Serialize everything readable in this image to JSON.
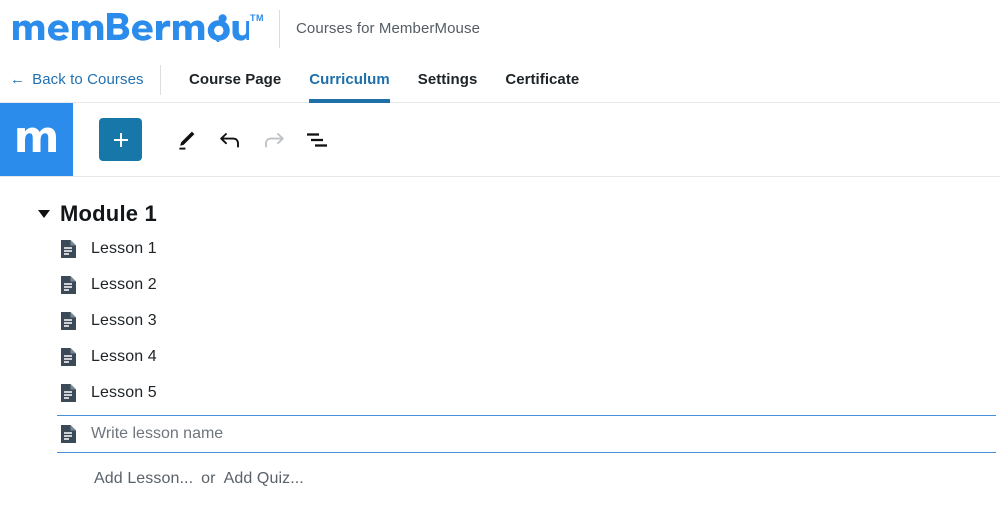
{
  "header": {
    "logo_text": "membermouse",
    "logo_tm": "TM",
    "title": "Courses for MemberMouse",
    "brand_color": "#2b8ceb"
  },
  "tabbar": {
    "back_arrow": "←",
    "back_label": "Back to Courses",
    "tabs": [
      {
        "label": "Course Page",
        "active": false
      },
      {
        "label": "Curriculum",
        "active": true
      },
      {
        "label": "Settings",
        "active": false
      },
      {
        "label": "Certificate",
        "active": false
      }
    ],
    "active_color": "#1f70a9"
  },
  "toolbar": {
    "brand_square_glyph": "m",
    "brand_square_color": "#2b8ceb",
    "add_button_label": "+",
    "add_button_color": "#1777a8",
    "icons": [
      {
        "name": "pencil-icon",
        "state": "enabled"
      },
      {
        "name": "undo-icon",
        "state": "enabled"
      },
      {
        "name": "redo-icon",
        "state": "disabled"
      },
      {
        "name": "collapse-all-icon",
        "state": "enabled"
      }
    ]
  },
  "curriculum": {
    "module": {
      "title": "Module 1",
      "expanded": true,
      "lessons": [
        {
          "label": "Lesson 1",
          "icon": "document-icon"
        },
        {
          "label": "Lesson 2",
          "icon": "document-icon"
        },
        {
          "label": "Lesson 3",
          "icon": "document-icon"
        },
        {
          "label": "Lesson 4",
          "icon": "document-icon"
        },
        {
          "label": "Lesson 5",
          "icon": "document-icon"
        }
      ]
    },
    "new_lesson": {
      "placeholder": "Write lesson name",
      "value": "",
      "icon": "document-icon",
      "focus_border_color": "#4a90d9"
    },
    "add_actions": {
      "add_lesson": "Add Lesson...",
      "separator": "or",
      "add_quiz": "Add Quiz..."
    }
  }
}
